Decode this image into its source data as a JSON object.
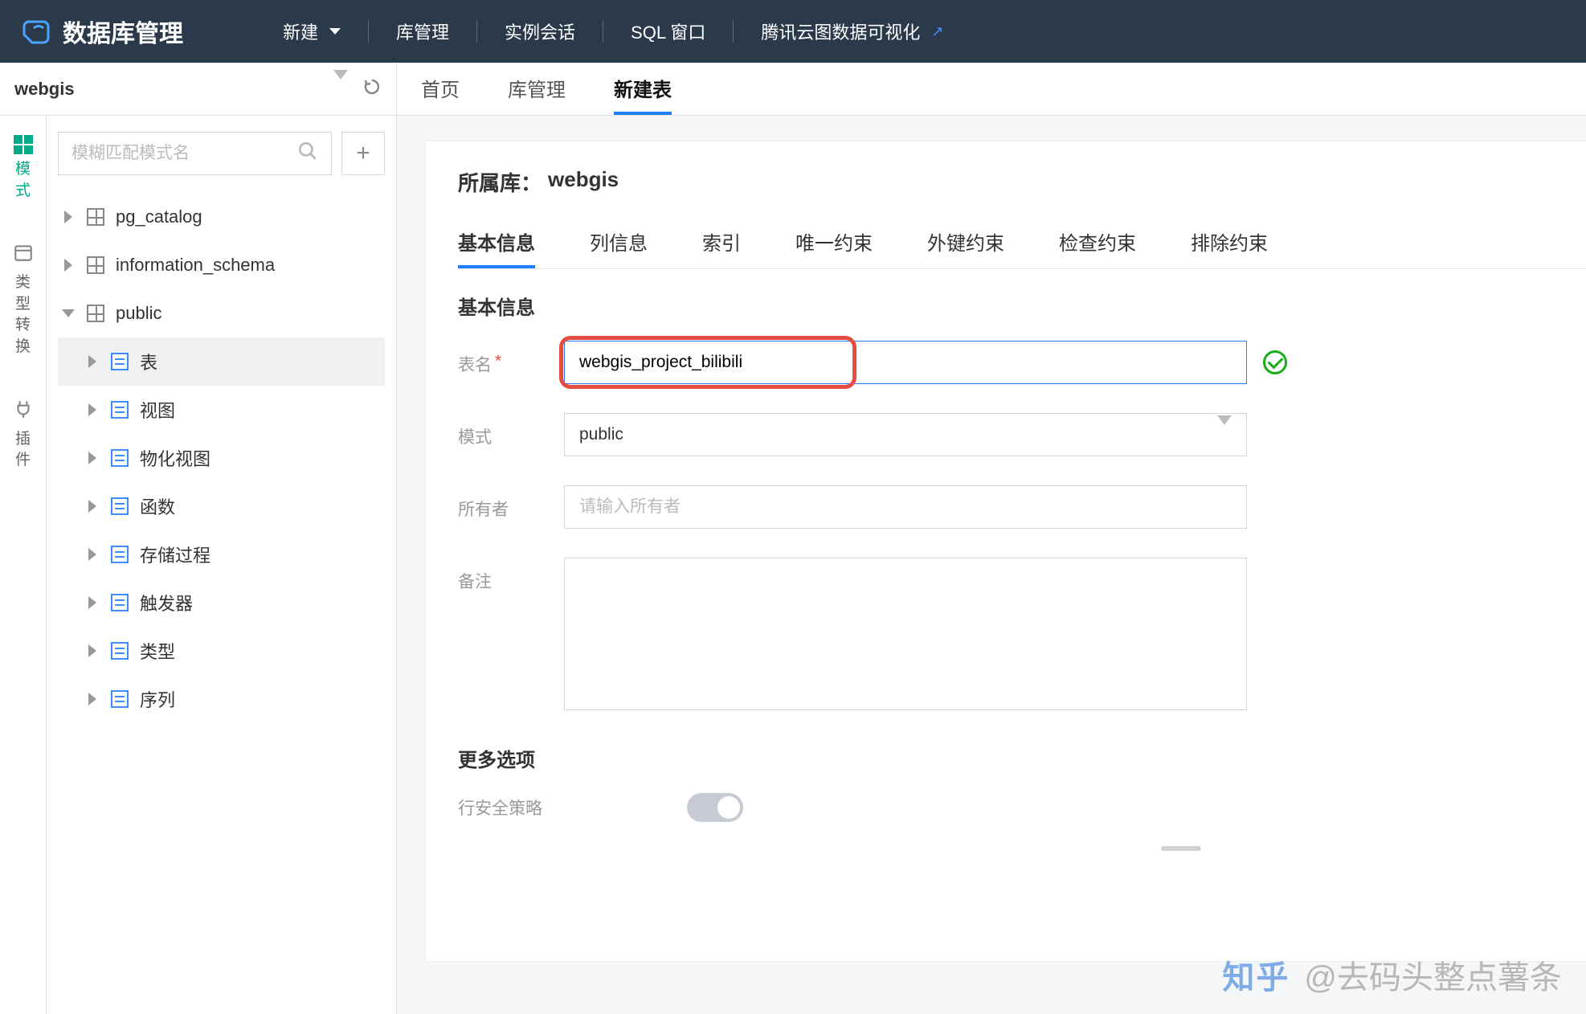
{
  "header": {
    "app_title": "数据库管理",
    "menu": {
      "new": "新建",
      "db_manage": "库管理",
      "session": "实例会话",
      "sql_window": "SQL 窗口",
      "yuntu": "腾讯云图数据可视化"
    }
  },
  "sidebar": {
    "db_name": "webgis",
    "search_placeholder": "模糊匹配模式名",
    "side_tabs": {
      "schema": "模\n式",
      "type_convert": "类\n型\n转\n换",
      "plugin": "插\n件"
    },
    "schemas": [
      {
        "name": "pg_catalog",
        "expanded": false
      },
      {
        "name": "information_schema",
        "expanded": false
      },
      {
        "name": "public",
        "expanded": true
      }
    ],
    "public_children": [
      {
        "label": "表",
        "selected": true
      },
      {
        "label": "视图"
      },
      {
        "label": "物化视图"
      },
      {
        "label": "函数"
      },
      {
        "label": "存储过程"
      },
      {
        "label": "触发器"
      },
      {
        "label": "类型"
      },
      {
        "label": "序列"
      }
    ]
  },
  "main_tabs": {
    "home": "首页",
    "db_manage": "库管理",
    "create_table": "新建表"
  },
  "form": {
    "belong_label": "所属库：",
    "belong_db": "webgis",
    "tabs": {
      "basic": "基本信息",
      "columns": "列信息",
      "index": "索引",
      "unique": "唯一约束",
      "foreign": "外键约束",
      "check": "检查约束",
      "exclude": "排除约束"
    },
    "section_basic": "基本信息",
    "labels": {
      "table_name": "表名",
      "schema": "模式",
      "owner": "所有者",
      "remark": "备注"
    },
    "values": {
      "table_name": "webgis_project_bilibili",
      "schema": "public",
      "owner_placeholder": "请输入所有者",
      "remark": ""
    },
    "more_section": "更多选项",
    "row_security": "行安全策略"
  },
  "watermark": {
    "logo": "知乎",
    "text": "@去码头整点薯条"
  }
}
